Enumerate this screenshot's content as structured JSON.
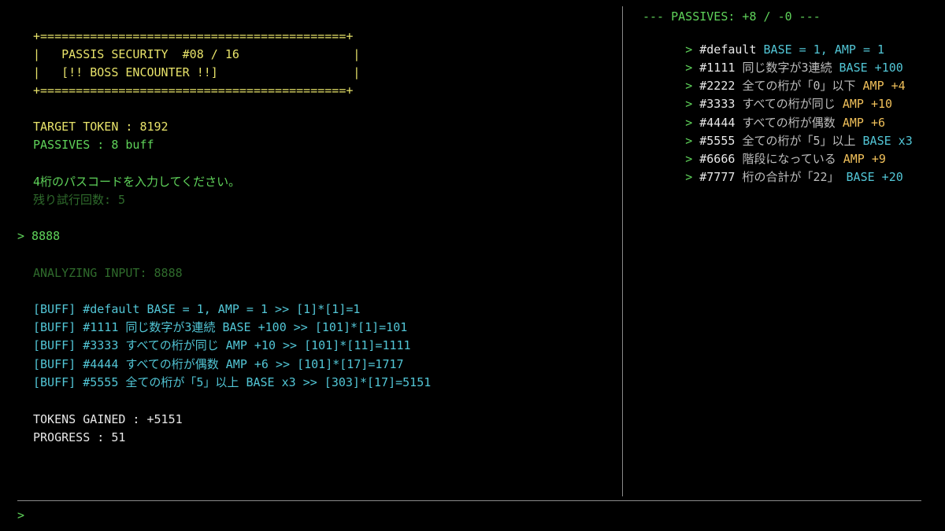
{
  "colors": {
    "yellow": "#e8e36a",
    "green": "#5fd35a",
    "dim_green": "#2f6b2c",
    "cyan": "#52c6d6",
    "white": "#e8e8e8",
    "amp_orange": "#f0c05a"
  },
  "banner": {
    "top": "+===========================================+",
    "title": "|   PASSIS SECURITY  #08 / 16                |",
    "subtitle": "|   [!! BOSS ENCOUNTER !!]                   |",
    "bottom": "+===========================================+"
  },
  "status": {
    "target_token": "TARGET TOKEN : 8192",
    "passives": "PASSIVES : 8 buff"
  },
  "prompt": {
    "instruction": "4桁のパスコードを入力してください。",
    "remaining": "残り試行回数: 5",
    "user_input": "> 8888"
  },
  "analysis": {
    "analyzing": "ANALYZING INPUT: 8888",
    "buffs": [
      "[BUFF] #default BASE = 1, AMP = 1 >> [1]*[1]=1",
      "[BUFF] #1111 同じ数字が3連続 BASE +100 >> [101]*[1]=101",
      "[BUFF] #3333 すべての桁が同じ AMP +10 >> [101]*[11]=1111",
      "[BUFF] #4444 すべての桁が偶数 AMP +6 >> [101]*[17]=1717",
      "[BUFF] #5555 全ての桁が「5」以上 BASE x3 >> [303]*[17]=5151"
    ],
    "tokens_gained": "TOKENS GAINED : +5151",
    "progress": "PROGRESS : 51"
  },
  "passives_panel": {
    "header": "--- PASSIVES: +8 / -0 ---",
    "marker": ">",
    "items": [
      {
        "id": "#default",
        "desc": "",
        "effect": "BASE = 1, AMP = 1",
        "kind": "base"
      },
      {
        "id": "#1111",
        "desc": "同じ数字が3連続",
        "effect": "BASE +100",
        "kind": "base"
      },
      {
        "id": "#2222",
        "desc": "全ての桁が「0」以下",
        "effect": "AMP +4",
        "kind": "amp"
      },
      {
        "id": "#3333",
        "desc": "すべての桁が同じ",
        "effect": "AMP +10",
        "kind": "amp"
      },
      {
        "id": "#4444",
        "desc": "すべての桁が偶数",
        "effect": "AMP +6",
        "kind": "amp"
      },
      {
        "id": "#5555",
        "desc": "全ての桁が「5」以上",
        "effect": "BASE x3",
        "kind": "base"
      },
      {
        "id": "#6666",
        "desc": "階段になっている",
        "effect": "AMP +9",
        "kind": "amp"
      },
      {
        "id": "#7777",
        "desc": "桁の合計が「22」",
        "effect": "BASE +20",
        "kind": "base"
      }
    ]
  },
  "command_line": {
    "prompt": ">"
  }
}
